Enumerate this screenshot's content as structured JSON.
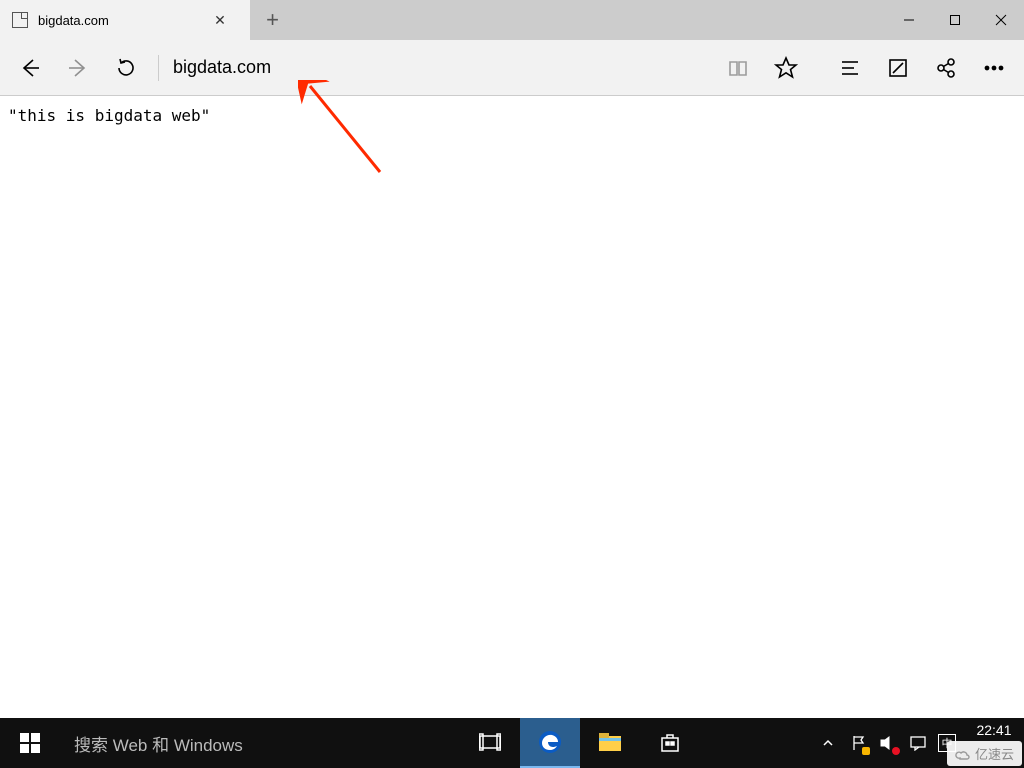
{
  "browser": {
    "tab_title": "bigdata.com",
    "address": "bigdata.com",
    "page_text": "\"this is bigdata web\""
  },
  "toolbar_icons": {
    "back": "back",
    "forward": "forward",
    "refresh": "refresh",
    "reading_view": "reading-view",
    "favorite": "favorite",
    "hub": "hub",
    "webnote": "webnote",
    "share": "share",
    "more": "more"
  },
  "window_controls": {
    "minimize": "minimize",
    "maximize": "maximize",
    "close": "close"
  },
  "taskbar": {
    "search_placeholder": "搜索 Web 和 Windows",
    "ime": "中",
    "time": "22:41",
    "date": ""
  },
  "watermark": "亿速云"
}
